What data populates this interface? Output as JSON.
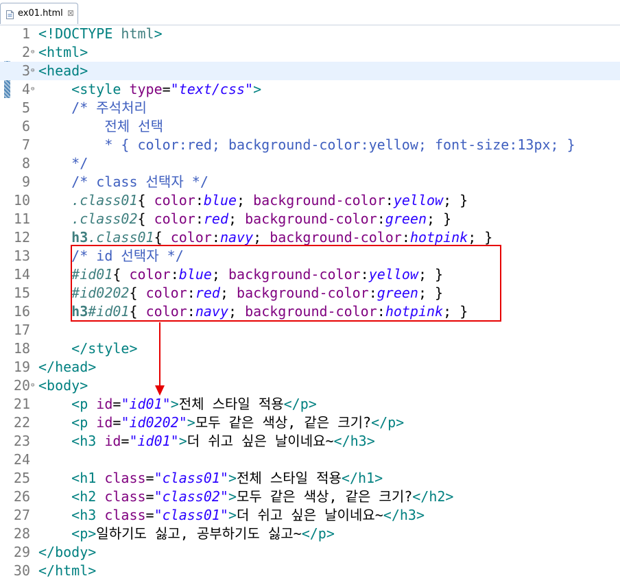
{
  "tab": {
    "title": "ex01.html",
    "close_glyph": "⊠",
    "icon": "html-file-icon"
  },
  "annotation": {
    "box_color": "#e60000",
    "arrow_color": "#e60000"
  },
  "current_line": 3,
  "lines": [
    {
      "n": "1",
      "fold": "",
      "tokens": [
        [
          "lnk",
          "<!DOCTYPE "
        ],
        [
          "kw",
          "html"
        ],
        [
          "lnk",
          ">"
        ]
      ]
    },
    {
      "n": "2",
      "fold": "⊖",
      "tokens": [
        [
          "lnk",
          "<html>"
        ]
      ]
    },
    {
      "n": "3",
      "fold": "⊖",
      "tokens": [
        [
          "lnk",
          "<head>"
        ]
      ]
    },
    {
      "n": "4",
      "fold": "⊖",
      "tokens": [
        [
          "lnk",
          "    <style "
        ],
        [
          "an",
          "type"
        ],
        [
          "tx",
          "="
        ],
        [
          "av",
          "\"text/css\""
        ],
        [
          "lnk",
          ">"
        ]
      ]
    },
    {
      "n": "5",
      "fold": "",
      "tokens": [
        [
          "cm",
          "    /* 주석처리"
        ]
      ]
    },
    {
      "n": "6",
      "fold": "",
      "tokens": [
        [
          "cm",
          "        전체 선택"
        ]
      ]
    },
    {
      "n": "7",
      "fold": "",
      "tokens": [
        [
          "cm",
          "        * { color:red; background-color:yellow; font-size:13px; }"
        ]
      ]
    },
    {
      "n": "8",
      "fold": "",
      "tokens": [
        [
          "cm",
          "    */"
        ]
      ]
    },
    {
      "n": "9",
      "fold": "",
      "tokens": [
        [
          "cm",
          "    /* class 선택자 */"
        ]
      ]
    },
    {
      "n": "10",
      "fold": "",
      "tokens": [
        [
          "tx",
          "    "
        ],
        [
          "sel",
          ".class01"
        ],
        [
          "pu",
          "{ "
        ],
        [
          "pr",
          "color"
        ],
        [
          "pu",
          ":"
        ],
        [
          "pv",
          "blue"
        ],
        [
          "pu",
          "; "
        ],
        [
          "pr",
          "background-color"
        ],
        [
          "pu",
          ":"
        ],
        [
          "pv",
          "yellow"
        ],
        [
          "pu",
          "; }"
        ]
      ]
    },
    {
      "n": "11",
      "fold": "",
      "tokens": [
        [
          "tx",
          "    "
        ],
        [
          "sel",
          ".class02"
        ],
        [
          "pu",
          "{ "
        ],
        [
          "pr",
          "color"
        ],
        [
          "pu",
          ":"
        ],
        [
          "pv",
          "red"
        ],
        [
          "pu",
          "; "
        ],
        [
          "pr",
          "background-color"
        ],
        [
          "pu",
          ":"
        ],
        [
          "pv",
          "green"
        ],
        [
          "pu",
          "; }"
        ]
      ]
    },
    {
      "n": "12",
      "fold": "",
      "tokens": [
        [
          "tx",
          "    "
        ],
        [
          "bsel",
          "h3"
        ],
        [
          "sel",
          ".class01"
        ],
        [
          "pu",
          "{ "
        ],
        [
          "pr",
          "color"
        ],
        [
          "pu",
          ":"
        ],
        [
          "pv",
          "navy"
        ],
        [
          "pu",
          "; "
        ],
        [
          "pr",
          "background-color"
        ],
        [
          "pu",
          ":"
        ],
        [
          "pv",
          "hotpink"
        ],
        [
          "pu",
          "; }"
        ]
      ]
    },
    {
      "n": "13",
      "fold": "",
      "tokens": [
        [
          "cm",
          "    /* id 선택자 */"
        ]
      ]
    },
    {
      "n": "14",
      "fold": "",
      "tokens": [
        [
          "tx",
          "    "
        ],
        [
          "sel",
          "#id01"
        ],
        [
          "pu",
          "{ "
        ],
        [
          "pr",
          "color"
        ],
        [
          "pu",
          ":"
        ],
        [
          "pv",
          "blue"
        ],
        [
          "pu",
          "; "
        ],
        [
          "pr",
          "background-color"
        ],
        [
          "pu",
          ":"
        ],
        [
          "pv",
          "yellow"
        ],
        [
          "pu",
          "; }"
        ]
      ]
    },
    {
      "n": "15",
      "fold": "",
      "tokens": [
        [
          "tx",
          "    "
        ],
        [
          "sel",
          "#id0202"
        ],
        [
          "pu",
          "{ "
        ],
        [
          "pr",
          "color"
        ],
        [
          "pu",
          ":"
        ],
        [
          "pv",
          "red"
        ],
        [
          "pu",
          "; "
        ],
        [
          "pr",
          "background-color"
        ],
        [
          "pu",
          ":"
        ],
        [
          "pv",
          "green"
        ],
        [
          "pu",
          "; }"
        ]
      ]
    },
    {
      "n": "16",
      "fold": "",
      "tokens": [
        [
          "tx",
          "    "
        ],
        [
          "bsel",
          "h3"
        ],
        [
          "sel",
          "#id01"
        ],
        [
          "pu",
          "{ "
        ],
        [
          "pr",
          "color"
        ],
        [
          "pu",
          ":"
        ],
        [
          "pv",
          "navy"
        ],
        [
          "pu",
          "; "
        ],
        [
          "pr",
          "background-color"
        ],
        [
          "pu",
          ":"
        ],
        [
          "pv",
          "hotpink"
        ],
        [
          "pu",
          "; }"
        ]
      ]
    },
    {
      "n": "17",
      "fold": "",
      "tokens": []
    },
    {
      "n": "18",
      "fold": "",
      "tokens": [
        [
          "lnk",
          "    </style>"
        ]
      ]
    },
    {
      "n": "19",
      "fold": "",
      "tokens": [
        [
          "lnk",
          "</head>"
        ]
      ]
    },
    {
      "n": "20",
      "fold": "⊖",
      "tokens": [
        [
          "lnk",
          "<body>"
        ]
      ]
    },
    {
      "n": "21",
      "fold": "",
      "tokens": [
        [
          "lnk",
          "    <p "
        ],
        [
          "an",
          "id"
        ],
        [
          "tx",
          "="
        ],
        [
          "av",
          "\"id01\""
        ],
        [
          "lnk",
          ">"
        ],
        [
          "tx",
          "전체 스타일 적용"
        ],
        [
          "lnk",
          "</p>"
        ]
      ]
    },
    {
      "n": "22",
      "fold": "",
      "tokens": [
        [
          "lnk",
          "    <p "
        ],
        [
          "an",
          "id"
        ],
        [
          "tx",
          "="
        ],
        [
          "av",
          "\"id0202\""
        ],
        [
          "lnk",
          ">"
        ],
        [
          "tx",
          "모두 같은 색상, 같은 크기?"
        ],
        [
          "lnk",
          "</p>"
        ]
      ]
    },
    {
      "n": "23",
      "fold": "",
      "tokens": [
        [
          "lnk",
          "    <h3 "
        ],
        [
          "an",
          "id"
        ],
        [
          "tx",
          "="
        ],
        [
          "av",
          "\"id01\""
        ],
        [
          "lnk",
          ">"
        ],
        [
          "tx",
          "더 쉬고 싶은 날이네요~"
        ],
        [
          "lnk",
          "</h3>"
        ]
      ]
    },
    {
      "n": "24",
      "fold": "",
      "tokens": []
    },
    {
      "n": "25",
      "fold": "",
      "tokens": [
        [
          "lnk",
          "    <h1 "
        ],
        [
          "an",
          "class"
        ],
        [
          "tx",
          "="
        ],
        [
          "av",
          "\"class01\""
        ],
        [
          "lnk",
          ">"
        ],
        [
          "tx",
          "전체 스타일 적용"
        ],
        [
          "lnk",
          "</h1>"
        ]
      ]
    },
    {
      "n": "26",
      "fold": "",
      "tokens": [
        [
          "lnk",
          "    <h2 "
        ],
        [
          "an",
          "class"
        ],
        [
          "tx",
          "="
        ],
        [
          "av",
          "\"class02\""
        ],
        [
          "lnk",
          ">"
        ],
        [
          "tx",
          "모두 같은 색상, 같은 크기?"
        ],
        [
          "lnk",
          "</h2>"
        ]
      ]
    },
    {
      "n": "27",
      "fold": "",
      "tokens": [
        [
          "lnk",
          "    <h3 "
        ],
        [
          "an",
          "class"
        ],
        [
          "tx",
          "="
        ],
        [
          "av",
          "\"class01\""
        ],
        [
          "lnk",
          ">"
        ],
        [
          "tx",
          "더 쉬고 싶은 날이네요~"
        ],
        [
          "lnk",
          "</h3>"
        ]
      ]
    },
    {
      "n": "28",
      "fold": "",
      "tokens": [
        [
          "lnk",
          "    <p>"
        ],
        [
          "tx",
          "일하기도 싫고, 공부하기도 싫고~"
        ],
        [
          "lnk",
          "</p>"
        ]
      ]
    },
    {
      "n": "29",
      "fold": "",
      "tokens": [
        [
          "lnk",
          "</body>"
        ]
      ]
    },
    {
      "n": "30",
      "fold": "",
      "tokens": [
        [
          "lnk",
          "</html>"
        ]
      ]
    }
  ]
}
